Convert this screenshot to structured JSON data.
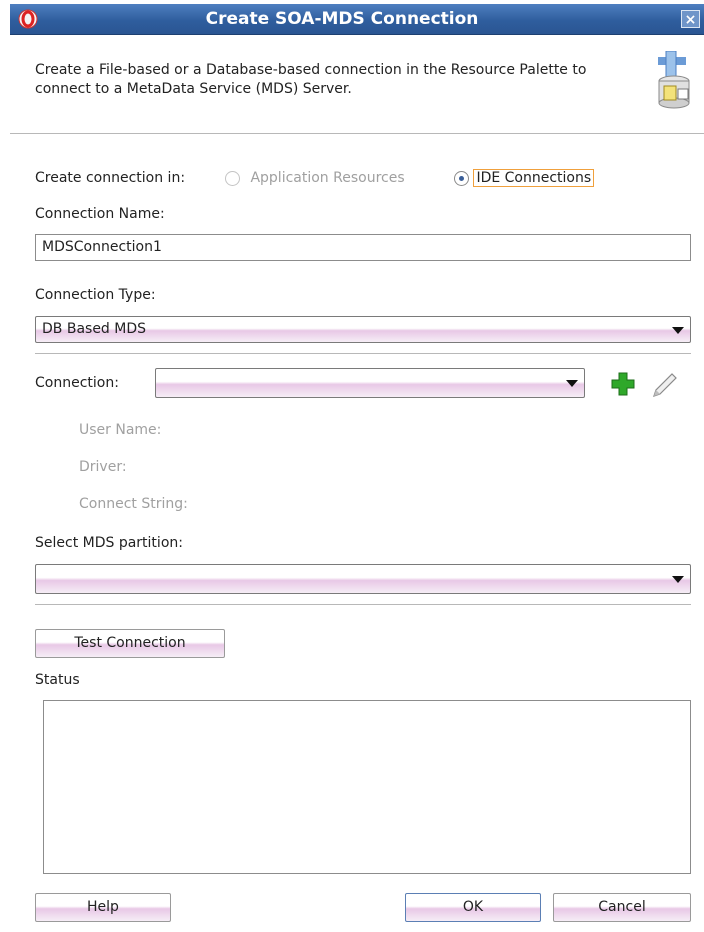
{
  "window": {
    "title": "Create SOA-MDS Connection",
    "close_glyph": "×"
  },
  "header": {
    "description": "Create a File-based or a Database-based connection in the Resource Palette to connect to a MetaData Service (MDS) Server.",
    "icon": "database-connection-icon"
  },
  "create_in": {
    "label": "Create connection in:",
    "options": [
      {
        "label": "Application Resources",
        "selected": false,
        "enabled": false
      },
      {
        "label": "IDE Connections",
        "selected": true,
        "enabled": true
      }
    ]
  },
  "connection_name": {
    "label": "Connection Name:",
    "value": "MDSConnection1"
  },
  "connection_type": {
    "label": "Connection Type:",
    "value": "DB Based MDS"
  },
  "connection": {
    "label": "Connection:",
    "value": "",
    "details": [
      "User Name:",
      "Driver:",
      "Connect String:"
    ],
    "add_icon": "plus-icon",
    "edit_icon": "pencil-icon"
  },
  "partition": {
    "label": "Select MDS partition:",
    "value": ""
  },
  "test_button": {
    "label": "Test Connection"
  },
  "status": {
    "label": "Status",
    "value": ""
  },
  "footer": {
    "help": "Help",
    "ok": "OK",
    "cancel": "Cancel"
  },
  "colors": {
    "titlebar": "#2f5e9e",
    "focus": "#f0a03c",
    "add_icon": "#2fa82a"
  }
}
